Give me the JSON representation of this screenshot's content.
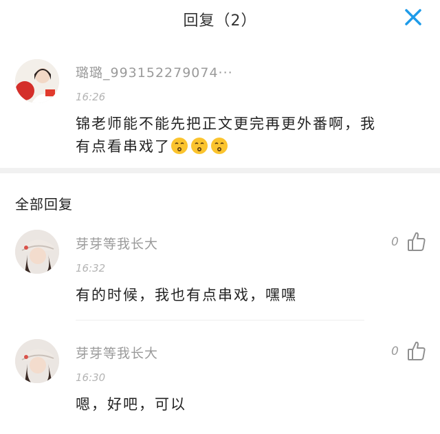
{
  "header": {
    "title": "回复（2）"
  },
  "main_comment": {
    "username": "璐璐_993152279074···",
    "time": "16:26",
    "text_line1": "锦老师能不能先把正文更完再更外番啊，我",
    "text_line2": "有点看串戏了"
  },
  "section": {
    "title": "全部回复"
  },
  "replies": [
    {
      "username": "芽芽等我长大",
      "time": "16:32",
      "text": "有的时候，我也有点串戏，嘿嘿",
      "likes": "0"
    },
    {
      "username": "芽芽等我长大",
      "time": "16:30",
      "text": "嗯，好吧，可以",
      "likes": "0"
    }
  ],
  "colors": {
    "accent": "#1e9be9",
    "muted": "#9a9a9a"
  }
}
